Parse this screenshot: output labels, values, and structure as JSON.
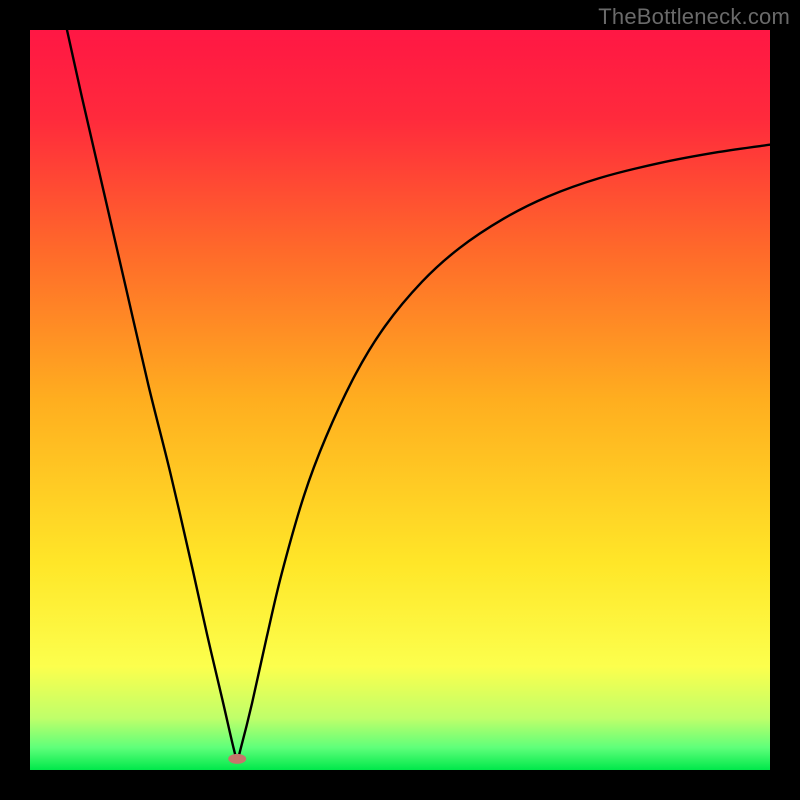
{
  "watermark": "TheBottleneck.com",
  "chart_data": {
    "type": "line",
    "title": "",
    "xlabel": "",
    "ylabel": "",
    "xlim": [
      0,
      100
    ],
    "ylim": [
      0,
      100
    ],
    "grid": false,
    "legend": false,
    "background_gradient": {
      "stops": [
        {
          "offset": 0.0,
          "color": "#ff1744"
        },
        {
          "offset": 0.12,
          "color": "#ff2a3c"
        },
        {
          "offset": 0.3,
          "color": "#ff6a2a"
        },
        {
          "offset": 0.5,
          "color": "#ffae1f"
        },
        {
          "offset": 0.72,
          "color": "#ffe628"
        },
        {
          "offset": 0.86,
          "color": "#fcff4d"
        },
        {
          "offset": 0.93,
          "color": "#bfff6a"
        },
        {
          "offset": 0.97,
          "color": "#5eff7a"
        },
        {
          "offset": 1.0,
          "color": "#00e84a"
        }
      ]
    },
    "min_marker": {
      "x": 28,
      "y": 1.5,
      "color": "#c6756b"
    },
    "series": [
      {
        "name": "curve",
        "color": "#000000",
        "points": [
          {
            "x": 5.0,
            "y": 100.0
          },
          {
            "x": 7.0,
            "y": 91.0
          },
          {
            "x": 10.0,
            "y": 78.0
          },
          {
            "x": 13.0,
            "y": 65.0
          },
          {
            "x": 16.0,
            "y": 52.0
          },
          {
            "x": 19.0,
            "y": 40.0
          },
          {
            "x": 22.0,
            "y": 27.0
          },
          {
            "x": 24.0,
            "y": 18.0
          },
          {
            "x": 26.0,
            "y": 9.5
          },
          {
            "x": 27.5,
            "y": 3.0
          },
          {
            "x": 28.0,
            "y": 1.5
          },
          {
            "x": 28.5,
            "y": 3.0
          },
          {
            "x": 30.0,
            "y": 9.0
          },
          {
            "x": 32.0,
            "y": 18.0
          },
          {
            "x": 34.0,
            "y": 26.5
          },
          {
            "x": 37.0,
            "y": 37.0
          },
          {
            "x": 40.0,
            "y": 45.0
          },
          {
            "x": 44.0,
            "y": 53.5
          },
          {
            "x": 48.0,
            "y": 60.0
          },
          {
            "x": 53.0,
            "y": 66.0
          },
          {
            "x": 58.0,
            "y": 70.5
          },
          {
            "x": 64.0,
            "y": 74.5
          },
          {
            "x": 70.0,
            "y": 77.5
          },
          {
            "x": 77.0,
            "y": 80.0
          },
          {
            "x": 85.0,
            "y": 82.0
          },
          {
            "x": 93.0,
            "y": 83.5
          },
          {
            "x": 100.0,
            "y": 84.5
          }
        ]
      }
    ]
  }
}
